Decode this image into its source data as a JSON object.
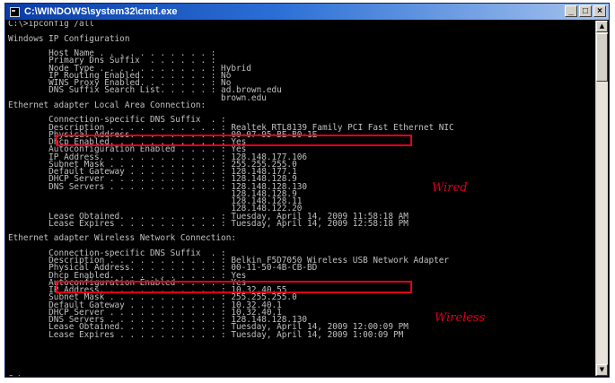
{
  "window": {
    "title": "C:\\WINDOWS\\system32\\cmd.exe",
    "controls": {
      "minimize": "_",
      "maximize": "□",
      "close": "×"
    }
  },
  "console_lines": [
    "C:\\>ipconfig /all",
    "",
    "Windows IP Configuration",
    "",
    "        Host Name . . . . . . . . . . . :",
    "        Primary Dns Suffix  . . . . . . :",
    "        Node Type . . . . . . . . . . . : Hybrid",
    "        IP Routing Enabled. . . . . . . : No",
    "        WINS Proxy Enabled. . . . . . . : No",
    "        DNS Suffix Search List. . . . . : ad.brown.edu",
    "                                          brown.edu",
    "Ethernet adapter Local Area Connection:",
    "",
    "        Connection-specific DNS Suffix  . :",
    "        Description . . . . . . . . . . . : Realtek RTL8139 Family PCI Fast Ethernet NIC",
    "        Physical Address. . . . . . . . . : 00-07-95-BE-B0-1E",
    "        Dhcp Enabled. . . . . . . . . . . : Yes",
    "        Autoconfiguration Enabled . . . . : Yes",
    "        IP Address. . . . . . . . . . . . : 128.148.177.106",
    "        Subnet Mask . . . . . . . . . . . : 255.255.255.0",
    "        Default Gateway . . . . . . . . . : 128.148.177.1",
    "        DHCP Server . . . . . . . . . . . : 128.148.128.9",
    "        DNS Servers . . . . . . . . . . . : 128.148.128.130",
    "                                            128.148.128.9",
    "                                            128.148.128.11",
    "                                            128.148.122.20",
    "        Lease Obtained. . . . . . . . . . : Tuesday, April 14, 2009 11:58:18 AM",
    "        Lease Expires . . . . . . . . . . : Tuesday, April 14, 2009 12:58:18 PM",
    "",
    "Ethernet adapter Wireless Network Connection:",
    "",
    "        Connection-specific DNS Suffix  . :",
    "        Description . . . . . . . . . . . : Belkin F5D7050 Wireless USB Network Adapter",
    "        Physical Address. . . . . . . . . : 00-11-50-4B-CB-BD",
    "        Dhcp Enabled. . . . . . . . . . . : Yes",
    "        Autoconfiguration Enabled . . . . : Yes",
    "        IP Address. . . . . . . . . . . . : 10.32.40.55",
    "        Subnet Mask . . . . . . . . . . . : 255.255.255.0",
    "        Default Gateway . . . . . . . . . : 10.32.40.1",
    "        DHCP Server . . . . . . . . . . . : 10.32.40.1",
    "        DNS Servers . . . . . . . . . . . : 128.148.128.130",
    "        Lease Obtained. . . . . . . . . . : Tuesday, April 14, 2009 12:00:09 PM",
    "        Lease Expires . . . . . . . . . . : Tuesday, April 14, 2009 1:00:09 PM",
    "",
    "",
    "",
    "",
    "",
    "C:\\>_"
  ],
  "annotations": {
    "wired_label": "Wired",
    "wireless_label": "Wireless",
    "highlight_color": "#e0001a"
  },
  "scrollbar": {
    "up_arrow": "▲",
    "down_arrow": "▼"
  }
}
